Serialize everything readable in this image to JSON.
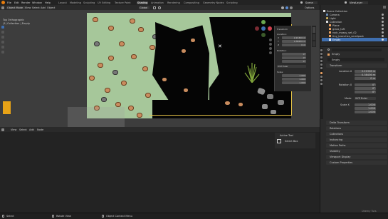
{
  "topbar": {
    "menus": [
      "File",
      "Edit",
      "Render",
      "Window",
      "Help"
    ],
    "workspaces": [
      "Layout",
      "Modeling",
      "Sculpting",
      "UV Editing",
      "Texture Paint",
      "Shading",
      "Animation",
      "Rendering",
      "Compositing",
      "Geometry Nodes",
      "Scripting"
    ],
    "active_workspace": "Shading",
    "scene": "Scene",
    "view_layer": "ViewLayer"
  },
  "viewport_header": {
    "mode": "Object Mode",
    "menus": [
      "View",
      "Select",
      "Add",
      "Object"
    ],
    "transform": "Global",
    "options": "Options"
  },
  "viewport_info": {
    "line1": "Top Orthographic",
    "line2": "(1) Collection | Empty"
  },
  "npanel": {
    "section": "Transform",
    "location_label": "Location:",
    "x_label": "X",
    "x_value": "2.21326 m",
    "y_label": "Y",
    "y_value": "0.38436 m",
    "z_label": "Z",
    "z_value": "0 m",
    "rotation_label": "Rotation:",
    "rot_x": "0°",
    "rot_y": "0°",
    "rot_z": "0°",
    "rot_mode": "XYZ Euler",
    "scale_label": "Scale:",
    "scale_x": "1.000",
    "scale_y": "1.000",
    "scale_z": "1.000"
  },
  "node_editor": {
    "menus": [
      "View",
      "Select",
      "Add",
      "Node"
    ]
  },
  "tool_panel": {
    "title": "Active Tool",
    "tool": "Select Box"
  },
  "outliner": {
    "items": [
      "Scene Collection",
      "Camera",
      "Light",
      "Collection",
      "Plane",
      "grass_tuft",
      "rock_mossy_set_02",
      "tiny_branches_smallpack",
      "Empty"
    ]
  },
  "properties": {
    "object_name": "Empty",
    "sub_name": "Empty",
    "sections": [
      "Transform",
      "Delta Transform",
      "Relations",
      "Collections",
      "Instancing",
      "Motion Paths",
      "Visibility",
      "Viewport Display",
      "Custom Properties"
    ],
    "location_label": "Location X",
    "loc_x": "2.21326 m",
    "loc_y": "0.38436 m",
    "loc_z": "0 m",
    "rotation_label": "Rotation X",
    "rot_x": "0°",
    "rot_y": "0°",
    "rot_z": "0°",
    "mode_label": "Mode",
    "mode": "XYZ Euler",
    "scale_label": "Scale X",
    "scale_x": "1.000",
    "scale_y": "1.000",
    "scale_z": "1.000"
  },
  "statusbar": {
    "select": "Select",
    "rotate": "Rotate View",
    "context": "Object Context Menu",
    "watermark": "Udemy Tuts"
  },
  "colors": {
    "texture_green": "#a6c79a",
    "accent_orange": "#e8a317",
    "selection_blue": "#3f6fb0"
  }
}
